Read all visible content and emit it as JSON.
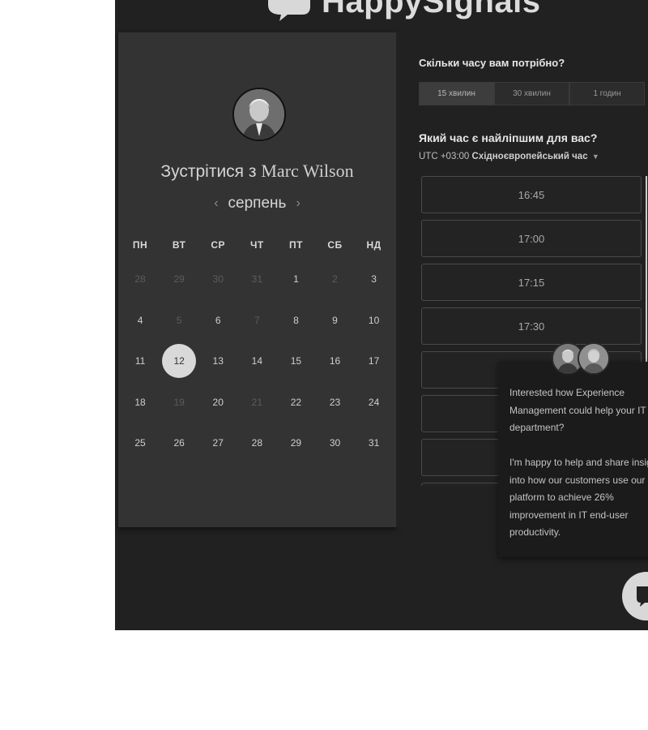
{
  "brand": {
    "name": "HappySignals"
  },
  "host": {
    "prefix": "Зустрітися з",
    "name": "Marc Wilson"
  },
  "calendar": {
    "month": "серпень",
    "prev_arrow": "‹",
    "next_arrow": "›",
    "weekdays": [
      "ПН",
      "ВТ",
      "СР",
      "ЧТ",
      "ПТ",
      "СБ",
      "НД"
    ],
    "weeks": [
      [
        {
          "d": "28",
          "m": true
        },
        {
          "d": "29",
          "m": true
        },
        {
          "d": "30",
          "m": true
        },
        {
          "d": "31",
          "m": true
        },
        {
          "d": "1",
          "m": false
        },
        {
          "d": "2",
          "m": true
        },
        {
          "d": "3",
          "m": false
        }
      ],
      [
        {
          "d": "4",
          "m": false
        },
        {
          "d": "5",
          "m": true
        },
        {
          "d": "6",
          "m": false
        },
        {
          "d": "7",
          "m": true
        },
        {
          "d": "8",
          "m": false
        },
        {
          "d": "9",
          "m": false
        },
        {
          "d": "10",
          "m": false
        }
      ],
      [
        {
          "d": "11",
          "m": false
        },
        {
          "d": "12",
          "m": false,
          "sel": true
        },
        {
          "d": "13",
          "m": false
        },
        {
          "d": "14",
          "m": false
        },
        {
          "d": "15",
          "m": false
        },
        {
          "d": "16",
          "m": false
        },
        {
          "d": "17",
          "m": false
        }
      ],
      [
        {
          "d": "18",
          "m": false
        },
        {
          "d": "19",
          "m": true
        },
        {
          "d": "20",
          "m": false
        },
        {
          "d": "21",
          "m": true
        },
        {
          "d": "22",
          "m": false
        },
        {
          "d": "23",
          "m": false
        },
        {
          "d": "24",
          "m": false
        }
      ],
      [
        {
          "d": "25",
          "m": false
        },
        {
          "d": "26",
          "m": false
        },
        {
          "d": "27",
          "m": false
        },
        {
          "d": "28",
          "m": false
        },
        {
          "d": "29",
          "m": false
        },
        {
          "d": "30",
          "m": false
        },
        {
          "d": "31",
          "m": false
        }
      ]
    ]
  },
  "scheduler": {
    "duration_question": "Скільки часу вам потрібно?",
    "durations": [
      "15 хвилин",
      "30 хвилин",
      "1 годин"
    ],
    "time_question": "Який час є найліпшим для вас?",
    "tz_offset": "UTC +03:00",
    "tz_name": "Східноєвропейський час",
    "slots": [
      "16:45",
      "17:00",
      "17:15",
      "17:30",
      "",
      "",
      "",
      ""
    ]
  },
  "chat": {
    "message_1": "Interested how Experience Management could help your IT department?",
    "message_2": "I'm happy to help and share insight into how our customers use our platform to achieve 26% improvement in IT end-user productivity."
  },
  "colors": {
    "page_bg": "#212121",
    "panel_bg": "#333333",
    "selected_day": "#d9d9d9"
  }
}
